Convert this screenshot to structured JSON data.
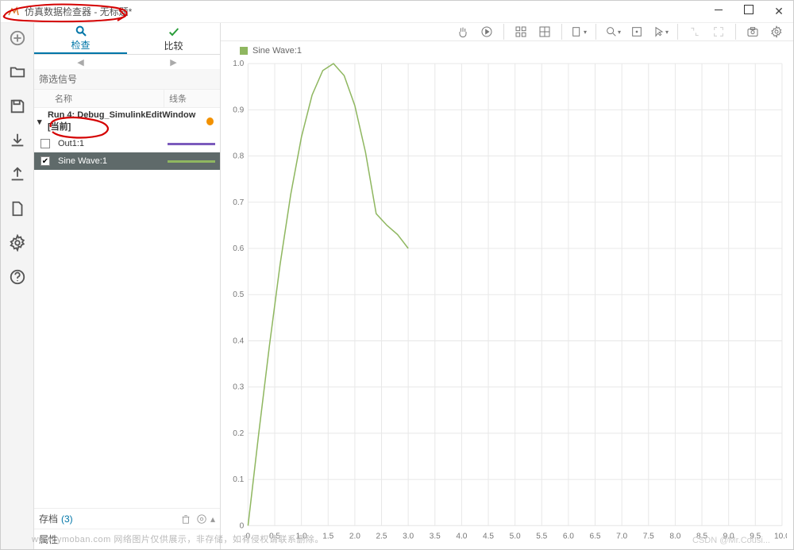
{
  "app": {
    "title": "仿真数据检查器 - 无标题*"
  },
  "tabs": {
    "inspect": "检查",
    "compare": "比较"
  },
  "filter_label": "筛选信号",
  "columns": {
    "name": "名称",
    "line": "线条"
  },
  "run": {
    "label": "Run 4: Debug_SimulinkEditWindow [当前]"
  },
  "signals": [
    {
      "name": "Out1:1",
      "color": "#7b5bbd",
      "checked": false
    },
    {
      "name": "Sine Wave:1",
      "color": "#8fb760",
      "checked": true
    }
  ],
  "archive": {
    "label": "存档",
    "count": "(3)"
  },
  "properties_label": "属性",
  "legend": {
    "label": "Sine Wave:1"
  },
  "chart_data": {
    "type": "line",
    "title": "",
    "xlabel": "",
    "ylabel": "",
    "xlim": [
      0,
      10
    ],
    "ylim": [
      0,
      1.0
    ],
    "xticks": [
      0,
      0.5,
      1.0,
      1.5,
      2.0,
      2.5,
      3.0,
      3.5,
      4.0,
      4.5,
      5.0,
      5.5,
      6.0,
      6.5,
      7.0,
      7.5,
      8.0,
      8.5,
      9.0,
      9.5,
      10.0
    ],
    "yticks": [
      0,
      0.1,
      0.2,
      0.3,
      0.4,
      0.5,
      0.6,
      0.7,
      0.8,
      0.9,
      1.0
    ],
    "series": [
      {
        "name": "Sine Wave:1",
        "color": "#8fb760",
        "x": [
          0.0,
          0.2,
          0.4,
          0.6,
          0.8,
          1.0,
          1.2,
          1.4,
          1.6,
          1.8,
          2.0,
          2.2,
          2.4,
          2.6,
          2.8,
          3.0
        ],
        "values": [
          0.0,
          0.199,
          0.389,
          0.565,
          0.717,
          0.841,
          0.932,
          0.985,
          1.0,
          0.974,
          0.909,
          0.808,
          0.675,
          0.65,
          0.63,
          0.6
        ]
      }
    ]
  },
  "xtick_labels": [
    "0",
    "0.5",
    "1.0",
    "1.5",
    "2.0",
    "2.5",
    "3.0",
    "3.5",
    "4.0",
    "4.5",
    "5.0",
    "5.5",
    "6.0",
    "6.5",
    "7.0",
    "7.5",
    "8.0",
    "8.5",
    "9.0",
    "9.5",
    "10.0"
  ],
  "ytick_labels": [
    "0",
    "0.1",
    "0.2",
    "0.3",
    "0.4",
    "0.5",
    "0.6",
    "0.7",
    "0.8",
    "0.9",
    "1.0"
  ],
  "watermark": "www.  ymoban.com  网络图片仅供展示，非存储，如有侵权请联系删除。",
  "watermark2": "CSDN @Mr.Cousi..."
}
